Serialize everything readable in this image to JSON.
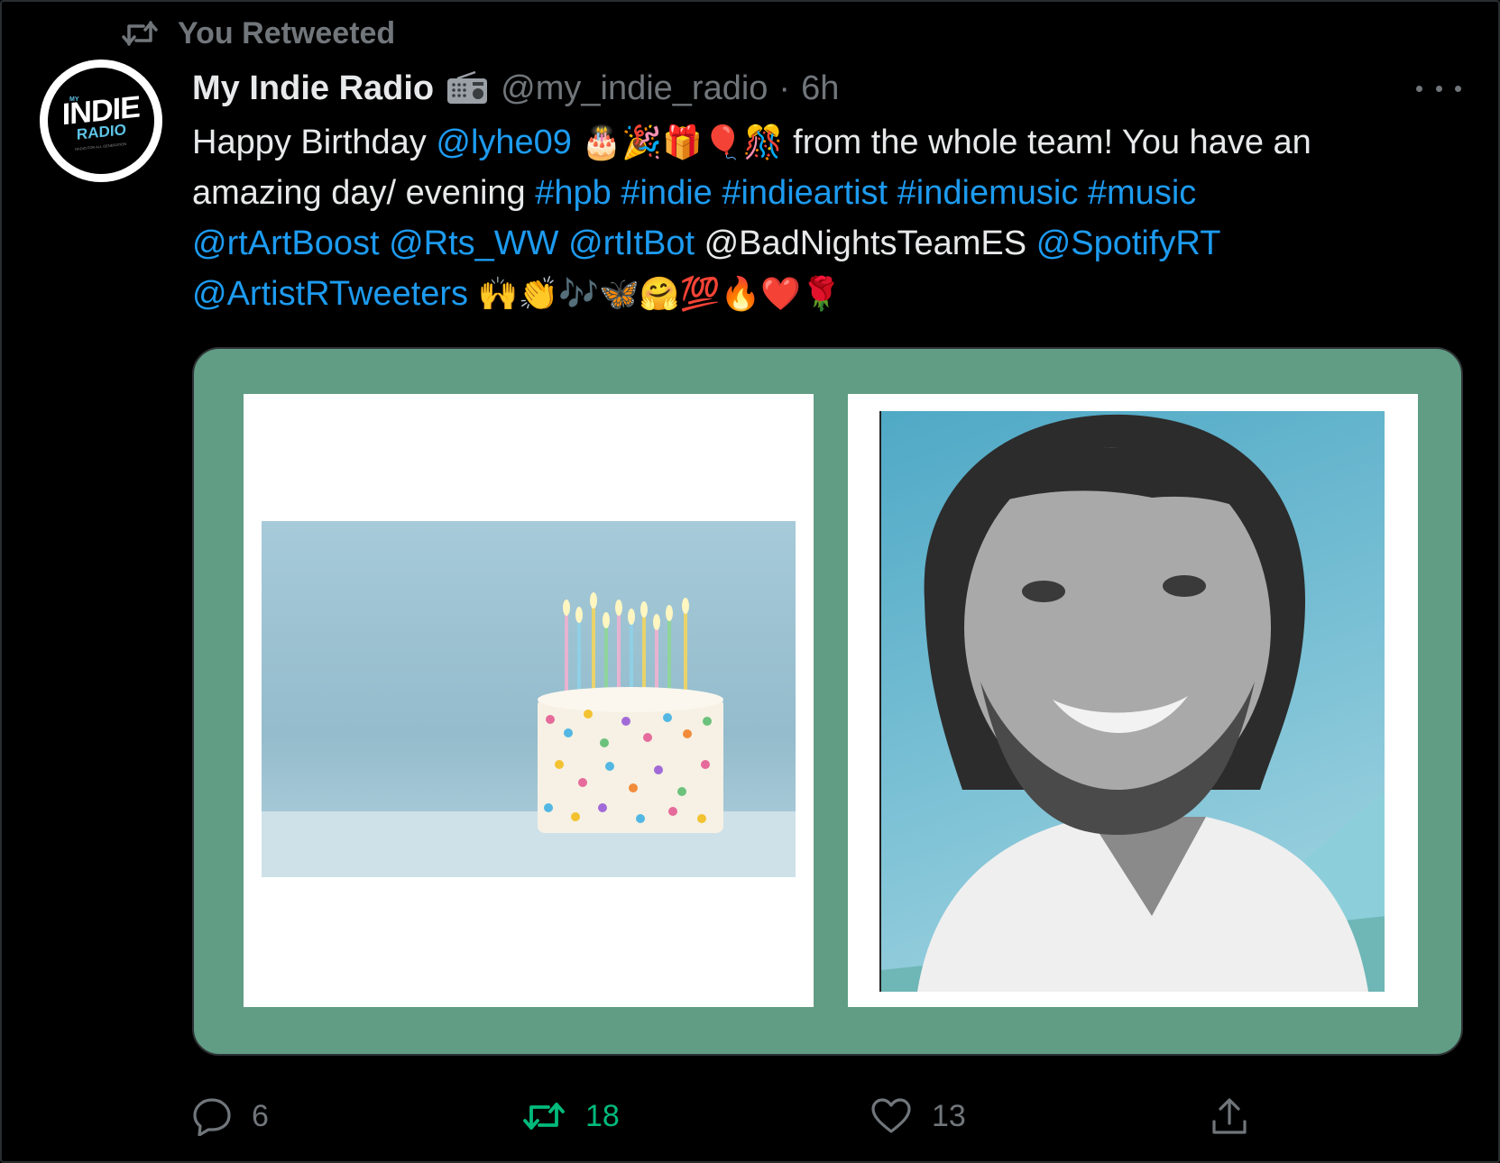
{
  "retweet_banner": {
    "label": "You Retweeted",
    "icon": "retweet-icon"
  },
  "account": {
    "name": "My Indie Radio",
    "badge_icon": "radio-icon",
    "handle": "@my_indie_radio",
    "separator": "·",
    "time": "6h",
    "avatar": {
      "top": "MY",
      "main": "INDIE",
      "sub": "RADIO",
      "tagline": "RADIO FOR ALL GENERATION"
    }
  },
  "tweet": {
    "line1": {
      "t1": "Happy Birthday ",
      "m1": "@lyhe09",
      "e1": "🎂🎉🎁🎈🎊",
      "t2": " from the whole team! You have an"
    },
    "line2": {
      "t1": "amazing day/ evening ",
      "h1": "#hpb",
      "h2": "#indie",
      "h3": "#indieartist",
      "h4": "#indiemusic",
      "h5": "#music"
    },
    "line3": {
      "m1": "@rtArtBoost",
      "m2": "@Rts_WW",
      "m3": "@rtItBot",
      "t1": "@BadNightsTeamES",
      "m4": "@SpotifyRT"
    },
    "line4": {
      "m1": "@ArtistRTweeters",
      "e1": "🙌👏🎶🦋🤗💯🔥❤️🌹"
    }
  },
  "actions": {
    "reply_count": "6",
    "retweet_count": "18",
    "like_count": "13"
  },
  "colors": {
    "background": "#000000",
    "link": "#1d9bf0",
    "muted": "#71767b",
    "retweet_active": "#00ba7c",
    "media_frame": "#609d84"
  }
}
